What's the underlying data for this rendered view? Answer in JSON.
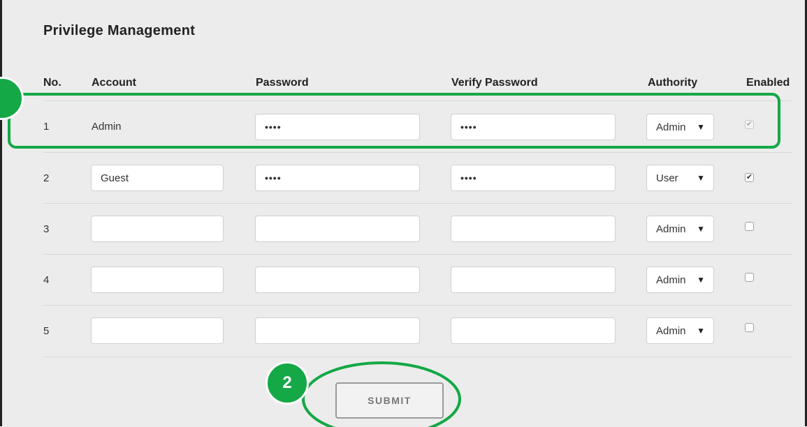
{
  "page": {
    "title": "Privilege Management"
  },
  "table": {
    "headers": {
      "no": "No.",
      "account": "Account",
      "password": "Password",
      "verify_password": "Verify Password",
      "authority": "Authority",
      "enabled": "Enabled"
    },
    "rows": [
      {
        "no": "1",
        "account": "Admin",
        "account_editable": false,
        "password": "••••",
        "verify_password": "••••",
        "authority": "Admin",
        "enabled": true,
        "enabled_disabled": true
      },
      {
        "no": "2",
        "account": "Guest",
        "account_editable": true,
        "password": "••••",
        "verify_password": "••••",
        "authority": "User",
        "enabled": true,
        "enabled_disabled": false
      },
      {
        "no": "3",
        "account": "",
        "account_editable": true,
        "password": "",
        "verify_password": "",
        "authority": "Admin",
        "enabled": false,
        "enabled_disabled": false
      },
      {
        "no": "4",
        "account": "",
        "account_editable": true,
        "password": "",
        "verify_password": "",
        "authority": "Admin",
        "enabled": false,
        "enabled_disabled": false
      },
      {
        "no": "5",
        "account": "",
        "account_editable": true,
        "password": "",
        "verify_password": "",
        "authority": "Admin",
        "enabled": false,
        "enabled_disabled": false
      }
    ]
  },
  "actions": {
    "submit_label": "SUBMIT"
  },
  "annotations": {
    "callout_2_label": "2",
    "accent_color": "#14a846",
    "highlight": "row-1"
  },
  "icons": {
    "checkbox_mark": "check-mark-icon",
    "dropdown": "caret-down-icon"
  }
}
